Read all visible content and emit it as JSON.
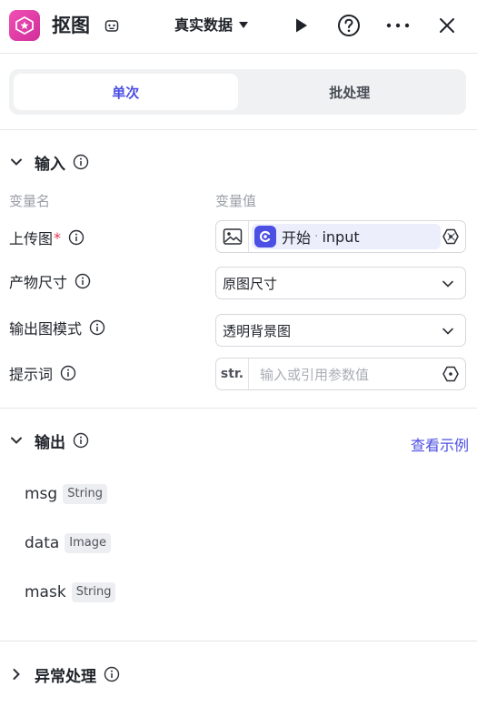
{
  "header": {
    "title": "抠图",
    "data_mode": "真实数据",
    "icons": {
      "app": "sticker-icon",
      "title": "robot-icon",
      "mode": "caret-down-icon",
      "run": "play-icon",
      "help": "help-icon",
      "more": "more-icon",
      "close": "close-icon"
    },
    "accent_color": "#4b4fe3",
    "app_color": "#e03fa8"
  },
  "tabs": [
    {
      "label": "单次",
      "active": true
    },
    {
      "label": "批处理",
      "active": false
    }
  ],
  "input_section": {
    "title": "输入",
    "col_name": "变量名",
    "col_value": "变量值",
    "rows": [
      {
        "label": "上传图",
        "required_mark": "*",
        "chip_node": "开始",
        "chip_sep": "·",
        "chip_var": "input",
        "chip_close": "×"
      },
      {
        "label": "产物尺寸",
        "value": "原图尺寸"
      },
      {
        "label": "输出图模式",
        "value": "透明背景图"
      },
      {
        "label": "提示词",
        "type_tag": "str.",
        "placeholder": "输入或引用参数值"
      }
    ]
  },
  "output_section": {
    "title": "输出",
    "link": "查看示例",
    "fields": [
      {
        "name": "msg",
        "type": "String"
      },
      {
        "name": "data",
        "type": "Image"
      },
      {
        "name": "mask",
        "type": "String"
      }
    ]
  },
  "error_section": {
    "title": "异常处理"
  }
}
